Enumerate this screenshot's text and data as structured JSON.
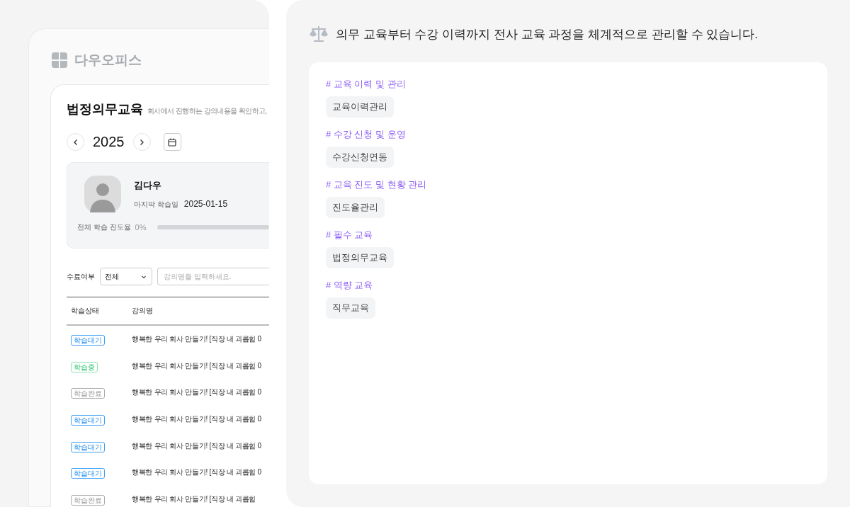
{
  "left_preview": {
    "brand": "다우오피스",
    "page_title": "법정의무교육",
    "page_subtitle": "회사에서 진행하는 강의내용을 확인하고,",
    "year": "2025",
    "profile": {
      "name": "김다우",
      "last_label": "마지막 학습일",
      "last_date": "2025-01-15",
      "progress_label": "전체 학습 진도율",
      "progress_value": "0%",
      "level": 0
    },
    "filter": {
      "label": "수료여부",
      "select_value": "전체",
      "search_placeholder": "강의명을 입력하세요."
    },
    "table": {
      "columns": [
        "학습상태",
        "강의명"
      ],
      "rows": [
        {
          "status": {
            "label": "학습대기",
            "kind": "waiting"
          },
          "title": "행복한 우리 회사 만들기! [직장 내 괴롭힘 0"
        },
        {
          "status": {
            "label": "학습중",
            "kind": "progress"
          },
          "title": "행복한 우리 회사 만들기! [직장 내 괴롭힘 0"
        },
        {
          "status": {
            "label": "학습완료",
            "kind": "done"
          },
          "title": "행복한 우리 회사 만들기! [직장 내 괴롭힘 0"
        },
        {
          "status": {
            "label": "학습대기",
            "kind": "waiting"
          },
          "title": "행복한 우리 회사 만들기! [직장 내 괴롭힘 0"
        },
        {
          "status": {
            "label": "학습대기",
            "kind": "waiting"
          },
          "title": "행복한 우리 회사 만들기! [직장 내 괴롭힘 0"
        },
        {
          "status": {
            "label": "학습대기",
            "kind": "waiting"
          },
          "title": "행복한 우리 회사 만들기! [직장 내 괴롭힘 0"
        },
        {
          "status": {
            "label": "학습완료",
            "kind": "done"
          },
          "title": "행복한 우리 회사 만들기! [직장 내 괴롭힘"
        }
      ]
    }
  },
  "right_panel": {
    "headline": "의무 교육부터 수강 이력까지 전사 교육 과정을 체계적으로 관리할 수 있습니다.",
    "sections": [
      {
        "heading": "# 교육 이력 및 관리",
        "tags": [
          "교육이력관리"
        ]
      },
      {
        "heading": "# 수강 신청 및 운영",
        "tags": [
          "수강신청연동"
        ]
      },
      {
        "heading": "# 교육 진도 및 현황 관리",
        "tags": [
          "진도율관리"
        ]
      },
      {
        "heading": "# 필수 교육",
        "tags": [
          "법정의무교육"
        ]
      },
      {
        "heading": "# 역량 교육",
        "tags": [
          "직무교육"
        ]
      }
    ]
  }
}
